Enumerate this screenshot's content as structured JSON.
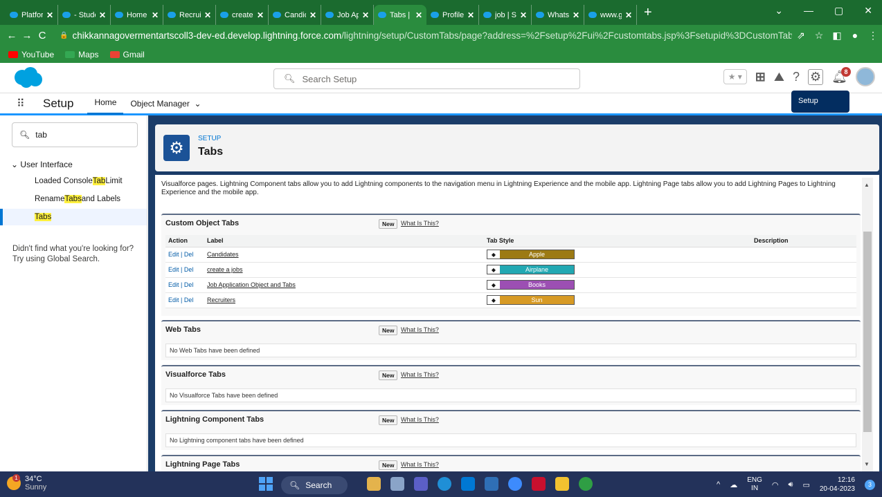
{
  "browser": {
    "tabs": [
      {
        "title": "Platform"
      },
      {
        "title": "- Studen"
      },
      {
        "title": "Home |"
      },
      {
        "title": "Recruite"
      },
      {
        "title": "create a"
      },
      {
        "title": "Candid"
      },
      {
        "title": "Job Ap"
      },
      {
        "title": "Tabs | S",
        "active": true
      },
      {
        "title": "Profiles"
      },
      {
        "title": "job | Sa"
      },
      {
        "title": "WhatsA"
      },
      {
        "title": "www.go"
      }
    ],
    "url_host": "chikkannagovermentartscoll3-dev-ed.develop.lightning.force.com",
    "url_path": "/lightning/setup/CustomTabs/page?address=%2Fsetup%2Fui%2Fcustomtabs.jsp%3Fsetupid%3DCustomTabs%26retURL%3D%252...",
    "bookmarks": [
      {
        "label": "YouTube",
        "color": "#ff0000"
      },
      {
        "label": "Maps",
        "color": "#34a853"
      },
      {
        "label": "Gmail",
        "color": "#ea4335"
      }
    ]
  },
  "header": {
    "search_placeholder": "Search Setup",
    "notification_count": "8"
  },
  "nav": {
    "app_title": "Setup",
    "tabs": [
      "Home",
      "Object Manager"
    ],
    "tooltip": "Setup"
  },
  "sidebar": {
    "quick_find": "tab",
    "section": "User Interface",
    "items": [
      {
        "pre": "Loaded Console ",
        "hl": "Tab",
        "post": " Limit"
      },
      {
        "pre": "Rename ",
        "hl": "Tabs",
        "post": " and Labels"
      },
      {
        "pre": "",
        "hl": "Tabs",
        "post": ""
      }
    ],
    "not_found_1": "Didn't find what you're looking for?",
    "not_found_2": "Try using Global Search."
  },
  "page": {
    "breadcrumb": "SETUP",
    "title": "Tabs",
    "description": "Visualforce pages. Lightning Component tabs allow you to add Lightning components to the navigation menu in Lightning Experience and the mobile app. Lightning Page tabs allow you to add Lightning Pages to Lightning Experience and the mobile app.",
    "new_label": "New",
    "what_label": "What Is This?",
    "custom": {
      "heading": "Custom Object Tabs",
      "columns": [
        "Action",
        "Label",
        "Tab Style",
        "Description"
      ],
      "edit": "Edit",
      "sep": " | ",
      "del": "Del",
      "rows": [
        {
          "label": "Candidates",
          "style": "Apple",
          "color": "#9c7a14"
        },
        {
          "label": "create a jobs",
          "style": "Airplane",
          "color": "#22a8b2"
        },
        {
          "label": "Job Application Object and Tabs",
          "style": "Books",
          "color": "#9c4fb3"
        },
        {
          "label": "Recruiters",
          "style": "Sun",
          "color": "#d79a25"
        }
      ]
    },
    "web": {
      "heading": "Web Tabs",
      "empty": "No Web Tabs have been defined"
    },
    "vf": {
      "heading": "Visualforce Tabs",
      "empty": "No Visualforce Tabs have been defined"
    },
    "lc": {
      "heading": "Lightning Component Tabs",
      "empty": "No Lightning component tabs have been defined"
    },
    "lp": {
      "heading": "Lightning Page Tabs"
    }
  },
  "taskbar": {
    "temp": "34°C",
    "weather": "Sunny",
    "search": "Search",
    "lang1": "ENG",
    "lang2": "IN",
    "time": "12:16",
    "date": "20-04-2023",
    "notif": "3"
  }
}
